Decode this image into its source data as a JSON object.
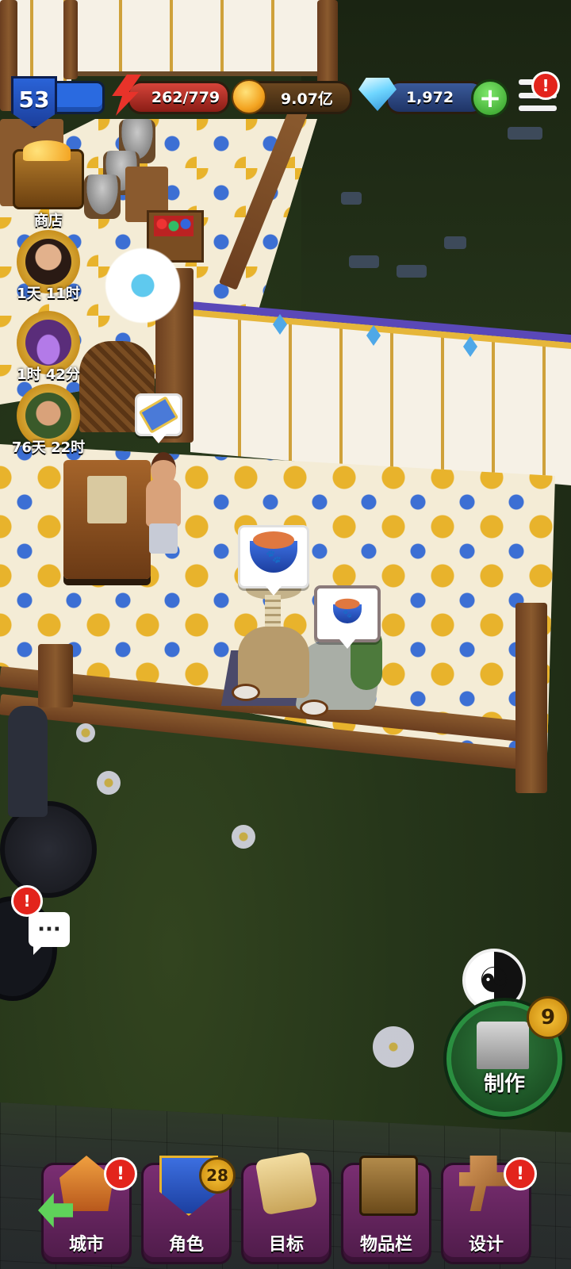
{
  "hud": {
    "level": "53",
    "energy": "262/779",
    "gold": "9.07亿",
    "gems": "1,972",
    "plus_symbol": "+",
    "menu_alert": "!"
  },
  "side_items": {
    "shop_label": "商店",
    "timer1": "1天 11时",
    "timer2": "1时 42分",
    "timer3": "76天 22时"
  },
  "chat": {
    "dots": "···",
    "alert": "!"
  },
  "craft": {
    "label": "制作",
    "count": "9"
  },
  "bottom_nav": {
    "city": {
      "label": "城市",
      "alert": "!"
    },
    "character": {
      "label": "角色",
      "count": "28"
    },
    "goals": {
      "label": "目标"
    },
    "inventory": {
      "label": "物品栏"
    },
    "design": {
      "label": "设计",
      "alert": "!"
    }
  },
  "colors": {
    "nav_purple": "#7a2e72",
    "craft_green": "#2a8f40",
    "alert_red": "#e3241c",
    "floor_gold": "#e8b32c",
    "floor_blue": "#3c6fd4"
  },
  "icons": [
    "level-shield-icon",
    "energy-icon",
    "coin-icon",
    "diamond-icon",
    "plus-icon",
    "menu-icon",
    "shop-chest-icon",
    "pet-bowl-icon",
    "ticket-icon",
    "chat-icon",
    "yin-yang-icon",
    "anvil-icon",
    "back-arrow-icon"
  ]
}
